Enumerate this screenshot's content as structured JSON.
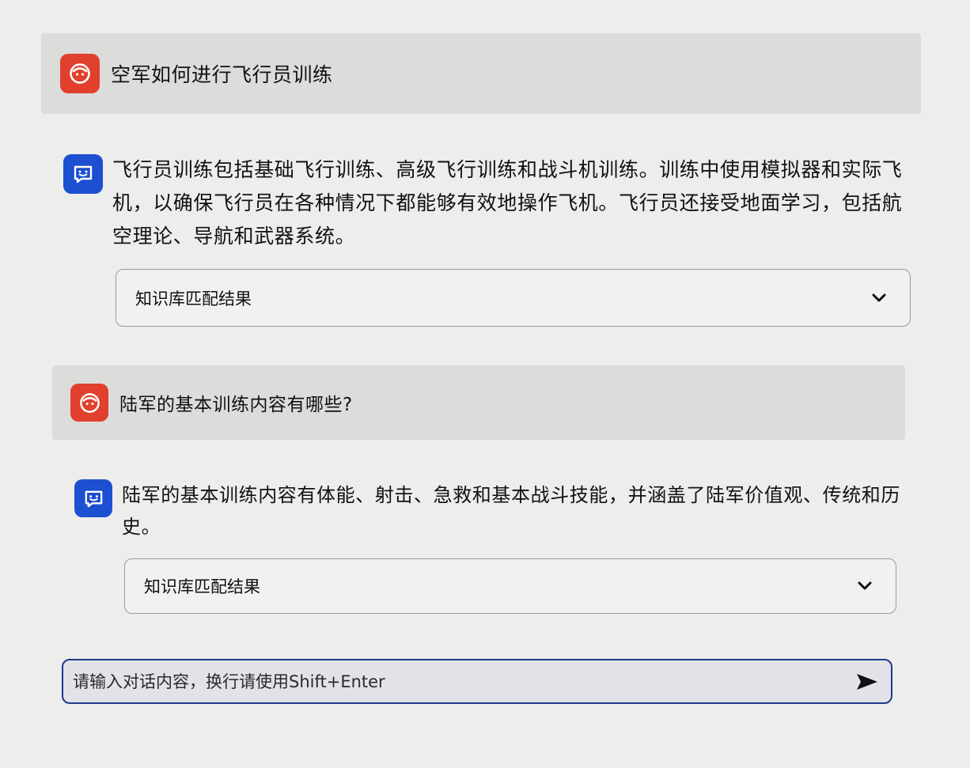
{
  "messages": [
    {
      "role": "user",
      "avatar_icon": "user-face-icon",
      "text": "空军如何进行飞行员训练"
    },
    {
      "role": "assistant",
      "avatar_icon": "chat-bot-icon",
      "text": "飞行员训练包括基础飞行训练、高级飞行训练和战斗机训练。训练中使用模拟器和实际飞机，以确保飞行员在各种情况下都能够有效地操作飞机。飞行员还接受地面学习，包括航空理论、导航和武器系统。",
      "knowledge": {
        "label": "知识库匹配结果",
        "icon": "chevron-down-icon"
      }
    },
    {
      "role": "user",
      "avatar_icon": "user-face-icon",
      "text": "陆军的基本训练内容有哪些?"
    },
    {
      "role": "assistant",
      "avatar_icon": "chat-bot-icon",
      "text": "陆军的基本训练内容有体能、射击、急救和基本战斗技能，并涵盖了陆军价值观、传统和历史。",
      "knowledge": {
        "label": "知识库匹配结果",
        "icon": "chevron-down-icon"
      }
    }
  ],
  "input": {
    "placeholder": "请输入对话内容，换行请使用Shift+Enter",
    "value": "",
    "send_icon": "send-icon"
  },
  "colors": {
    "user_avatar": "#e0402d",
    "bot_avatar": "#1d4fd1",
    "input_border": "#1f3a8a"
  }
}
